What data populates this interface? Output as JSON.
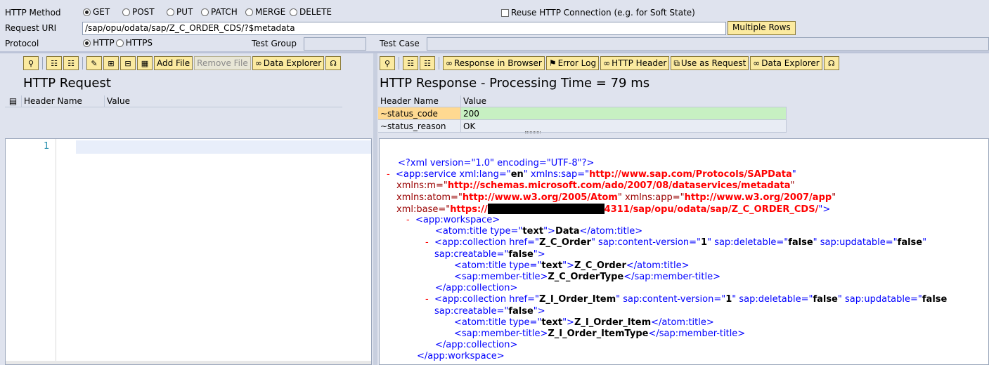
{
  "form": {
    "method_label": "HTTP Method",
    "methods": [
      "GET",
      "POST",
      "PUT",
      "PATCH",
      "MERGE",
      "DELETE"
    ],
    "reuse_label": "Reuse HTTP Connection (e.g. for Soft State)",
    "uri_label": "Request URI",
    "uri_value": "/sap/opu/odata/sap/Z_C_ORDER_CDS/?$metadata",
    "multiple_rows": "Multiple Rows",
    "protocol_label": "Protocol",
    "protocols": [
      "HTTP",
      "HTTPS"
    ],
    "test_group_label": "Test Group",
    "test_case_label": "Test Case"
  },
  "request": {
    "toolbar": {
      "add_file": "Add File",
      "remove_file": "Remove File",
      "data_explorer": "Data Explorer"
    },
    "title": "HTTP Request",
    "col_name": "Header Name",
    "col_value": "Value",
    "line_number": "1"
  },
  "response": {
    "toolbar": {
      "response_in_browser": "Response in Browser",
      "error_log": "Error Log",
      "http_header": "HTTP Header",
      "use_as_request": "Use as Request",
      "data_explorer": "Data Explorer"
    },
    "title": "HTTP Response - Processing Time = 79  ms",
    "col_name": "Header Name",
    "col_value": "Value",
    "rows": [
      {
        "name": "~status_code",
        "value": "200"
      },
      {
        "name": "~status_reason",
        "value": "OK"
      }
    ]
  },
  "xml": {
    "decl": "<?xml version=\"1.0\" encoding=\"UTF-8\"?>",
    "minus": "-",
    "l1_a": "<app:service xml:lang=\"",
    "l1_v1": "en",
    "l1_b": "\" xmlns:sap=\"",
    "l1_v2": "http://www.sap.com/Protocols/SAPData",
    "l1_c": "\"",
    "l2_a": "xmlns:m=\"",
    "l2_v": "http://schemas.microsoft.com/ado/2007/08/dataservices/metadata",
    "l2_b": "\"",
    "l3_a": "xmlns:atom=\"",
    "l3_v1": "http://www.w3.org/2005/Atom",
    "l3_b": "\" xmlns:app=\"",
    "l3_v2": "http://www.w3.org/2007/app",
    "l3_c": "\"",
    "l4_a": "xml:base=\"",
    "l4_v1": "https://",
    "l4_v2": "4311/sap/opu/odata/sap/Z_C_ORDER_CDS/",
    "l4_b": "\">",
    "ws_open": "<app:workspace>",
    "t1_a": "<atom:title type=\"",
    "t1_v": "text",
    "t1_b": "\">",
    "t1_txt": "Data",
    "t1_c": "</atom:title>",
    "c1_a": "<app:collection href=\"",
    "c1_v1": "Z_C_Order",
    "c1_b": "\" sap:content-version=\"",
    "c1_v2": "1",
    "c1_c": "\" sap:deletable=\"",
    "c1_v3": "false",
    "c1_d": "\" sap:updatable=\"",
    "c1_v4": "false",
    "c1_e": "\"",
    "c1_f": "sap:creatable=\"",
    "c1_v5": "false",
    "c1_g": "\">",
    "c1t_a": "<atom:title type=\"",
    "c1t_v": "text",
    "c1t_b": "\">",
    "c1t_txt": "Z_C_Order",
    "c1t_c": "</atom:title>",
    "c1m_a": "<sap:member-title>",
    "c1m_txt": "Z_C_OrderType",
    "c1m_b": "</sap:member-title>",
    "coll_close": "</app:collection>",
    "c2_v1": "Z_I_Order_Item",
    "c2t_txt": "Z_I_Order_Item",
    "c2m_txt": "Z_I_Order_ItemType",
    "ws_close": "</app:workspace>"
  }
}
